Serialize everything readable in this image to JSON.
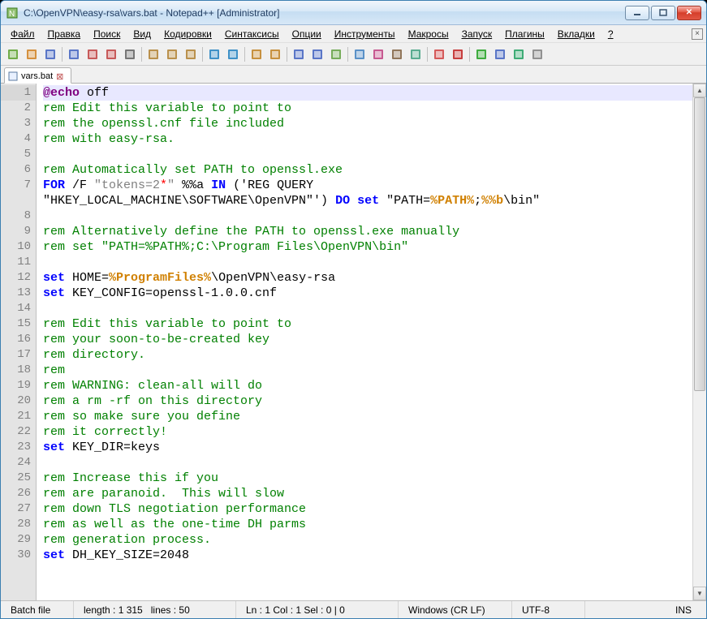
{
  "title": "C:\\OpenVPN\\easy-rsa\\vars.bat - Notepad++ [Administrator]",
  "menu": [
    "Файл",
    "Правка",
    "Поиск",
    "Вид",
    "Кодировки",
    "Синтаксисы",
    "Опции",
    "Инструменты",
    "Макросы",
    "Запуск",
    "Плагины",
    "Вкладки",
    "?"
  ],
  "tab": {
    "name": "vars.bat"
  },
  "lines": [
    {
      "n": 1,
      "seg": [
        {
          "c": "at",
          "t": "@echo"
        },
        {
          "c": "",
          "t": " off"
        }
      ]
    },
    {
      "n": 2,
      "seg": [
        {
          "c": "rem",
          "t": "rem Edit this variable to point to"
        }
      ]
    },
    {
      "n": 3,
      "seg": [
        {
          "c": "rem",
          "t": "rem the openssl.cnf file included"
        }
      ]
    },
    {
      "n": 4,
      "seg": [
        {
          "c": "rem",
          "t": "rem with easy-rsa."
        }
      ]
    },
    {
      "n": 5,
      "seg": []
    },
    {
      "n": 6,
      "seg": [
        {
          "c": "rem",
          "t": "rem Automatically set PATH to openssl.exe"
        }
      ]
    },
    {
      "n": 7,
      "seg": [
        {
          "c": "kw",
          "t": "FOR"
        },
        {
          "c": "",
          "t": " /F "
        },
        {
          "c": "str",
          "t": "\"tokens=2"
        },
        {
          "c": "star",
          "t": "*"
        },
        {
          "c": "str",
          "t": "\""
        },
        {
          "c": "",
          "t": " %%a "
        },
        {
          "c": "kw",
          "t": "IN"
        },
        {
          "c": "",
          "t": " ('REG QUERY"
        }
      ]
    },
    {
      "n": "",
      "seg": [
        {
          "c": "",
          "t": "\"HKEY_LOCAL_MACHINE\\SOFTWARE\\OpenVPN\"') "
        },
        {
          "c": "kw",
          "t": "DO"
        },
        {
          "c": "",
          "t": " "
        },
        {
          "c": "kw",
          "t": "set"
        },
        {
          "c": "",
          "t": " \"PATH="
        },
        {
          "c": "var",
          "t": "%PATH%"
        },
        {
          "c": "",
          "t": ";"
        },
        {
          "c": "var",
          "t": "%%b"
        },
        {
          "c": "",
          "t": "\\bin\""
        }
      ]
    },
    {
      "n": 8,
      "seg": []
    },
    {
      "n": 9,
      "seg": [
        {
          "c": "rem",
          "t": "rem Alternatively define the PATH to openssl.exe manually"
        }
      ]
    },
    {
      "n": 10,
      "seg": [
        {
          "c": "rem",
          "t": "rem set \"PATH=%PATH%;C:\\Program Files\\OpenVPN\\bin\""
        }
      ]
    },
    {
      "n": 11,
      "seg": []
    },
    {
      "n": 12,
      "seg": [
        {
          "c": "kw",
          "t": "set"
        },
        {
          "c": "",
          "t": " HOME="
        },
        {
          "c": "var",
          "t": "%ProgramFiles%"
        },
        {
          "c": "",
          "t": "\\OpenVPN\\easy-rsa"
        }
      ]
    },
    {
      "n": 13,
      "seg": [
        {
          "c": "kw",
          "t": "set"
        },
        {
          "c": "",
          "t": " KEY_CONFIG=openssl-1.0.0.cnf"
        }
      ]
    },
    {
      "n": 14,
      "seg": []
    },
    {
      "n": 15,
      "seg": [
        {
          "c": "rem",
          "t": "rem Edit this variable to point to"
        }
      ]
    },
    {
      "n": 16,
      "seg": [
        {
          "c": "rem",
          "t": "rem your soon-to-be-created key"
        }
      ]
    },
    {
      "n": 17,
      "seg": [
        {
          "c": "rem",
          "t": "rem directory."
        }
      ]
    },
    {
      "n": 18,
      "seg": [
        {
          "c": "rem",
          "t": "rem"
        }
      ]
    },
    {
      "n": 19,
      "seg": [
        {
          "c": "rem",
          "t": "rem WARNING: clean-all will do"
        }
      ]
    },
    {
      "n": 20,
      "seg": [
        {
          "c": "rem",
          "t": "rem a rm -rf on this directory"
        }
      ]
    },
    {
      "n": 21,
      "seg": [
        {
          "c": "rem",
          "t": "rem so make sure you define"
        }
      ]
    },
    {
      "n": 22,
      "seg": [
        {
          "c": "rem",
          "t": "rem it correctly!"
        }
      ]
    },
    {
      "n": 23,
      "seg": [
        {
          "c": "kw",
          "t": "set"
        },
        {
          "c": "",
          "t": " KEY_DIR=keys"
        }
      ]
    },
    {
      "n": 24,
      "seg": []
    },
    {
      "n": 25,
      "seg": [
        {
          "c": "rem",
          "t": "rem Increase this if you"
        }
      ]
    },
    {
      "n": 26,
      "seg": [
        {
          "c": "rem",
          "t": "rem are paranoid.  This will slow"
        }
      ]
    },
    {
      "n": 27,
      "seg": [
        {
          "c": "rem",
          "t": "rem down TLS negotiation performance"
        }
      ]
    },
    {
      "n": 28,
      "seg": [
        {
          "c": "rem",
          "t": "rem as well as the one-time DH parms"
        }
      ]
    },
    {
      "n": 29,
      "seg": [
        {
          "c": "rem",
          "t": "rem generation process."
        }
      ]
    },
    {
      "n": 30,
      "seg": [
        {
          "c": "kw",
          "t": "set"
        },
        {
          "c": "",
          "t": " DH_KEY_SIZE=2048"
        }
      ]
    }
  ],
  "status": {
    "lang": "Batch file",
    "length": "length : 1 315",
    "lines": "lines : 50",
    "pos": "Ln : 1   Col : 1   Sel : 0 | 0",
    "eol": "Windows (CR LF)",
    "enc": "UTF-8",
    "mode": "INS"
  },
  "toolbar_icons": [
    "new",
    "open",
    "save",
    "save-all",
    "close",
    "close-all",
    "print",
    "cut",
    "copy",
    "paste",
    "undo",
    "redo",
    "find",
    "replace",
    "zoom-in",
    "zoom-out",
    "sync",
    "wrap",
    "chars",
    "indent",
    "lang",
    "monitor",
    "record",
    "play",
    "stop",
    "playback",
    "prefs"
  ]
}
